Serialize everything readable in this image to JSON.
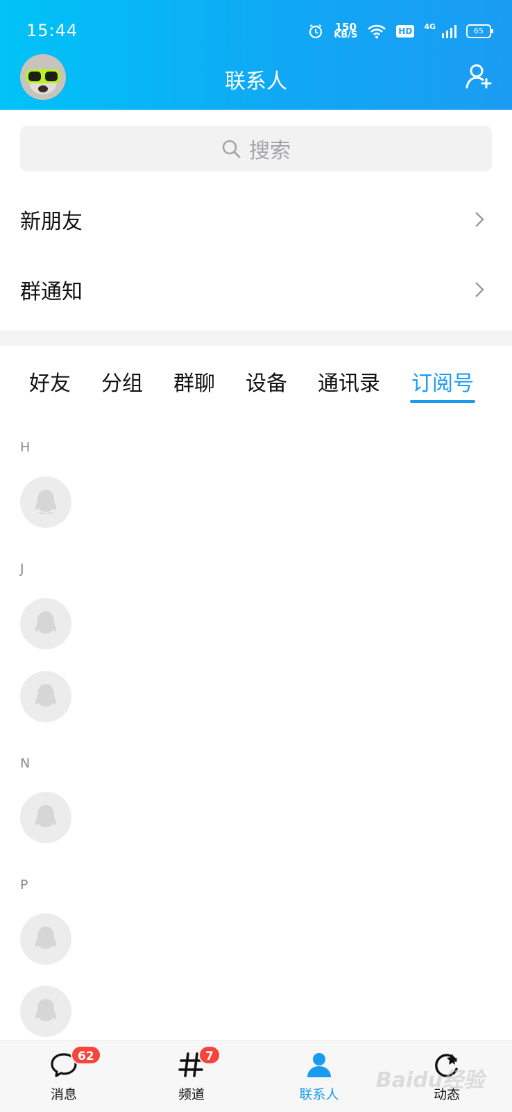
{
  "status_bar": {
    "time": "15:44",
    "speed_value": "150",
    "speed_unit": "KB/S",
    "hd": "HD",
    "network": "4G",
    "battery": "65"
  },
  "header": {
    "title": "联系人"
  },
  "search": {
    "placeholder": "搜索"
  },
  "entries": [
    {
      "label": "新朋友"
    },
    {
      "label": "群通知"
    }
  ],
  "tabs": [
    {
      "label": "好友"
    },
    {
      "label": "分组"
    },
    {
      "label": "群聊"
    },
    {
      "label": "设备"
    },
    {
      "label": "通讯录"
    },
    {
      "label": "订阅号",
      "active": true
    }
  ],
  "index_letters": [
    "H",
    "J",
    "N",
    "P"
  ],
  "bottom_nav": [
    {
      "label": "消息",
      "badge": "62"
    },
    {
      "label": "频道",
      "badge": "7"
    },
    {
      "label": "联系人",
      "active": true
    },
    {
      "label": "动态"
    }
  ],
  "watermark": "Baidu经验",
  "colors": {
    "accent": "#1a9bf2",
    "header_start": "#00c3f7",
    "badge": "#f5453d"
  }
}
